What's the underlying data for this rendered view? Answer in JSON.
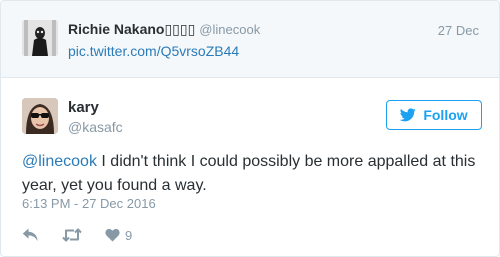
{
  "context_tweet": {
    "author_name": "Richie Nakano▯▯▯▯",
    "author_handle": "@linecook",
    "date": "27 Dec",
    "link_text": "pic.twitter.com/Q5vrsoZB44"
  },
  "tweet": {
    "author_name": "kary",
    "author_handle": "@kasafc",
    "follow_label": "Follow",
    "mention": "@linecook",
    "body": " I didn't think I could possibly be more appalled at this year, yet you found a way.",
    "timestamp": "6:13 PM - 27 Dec 2016",
    "like_count": "9"
  },
  "icons": {
    "follow": "twitter-bird-icon",
    "reply": "reply-icon",
    "retweet": "retweet-icon",
    "like": "heart-icon"
  },
  "colors": {
    "accent": "#1da1f2",
    "link": "#2b7bb9",
    "muted": "#8899a6",
    "text": "#292f33",
    "context_bg": "#f5f8fa"
  }
}
